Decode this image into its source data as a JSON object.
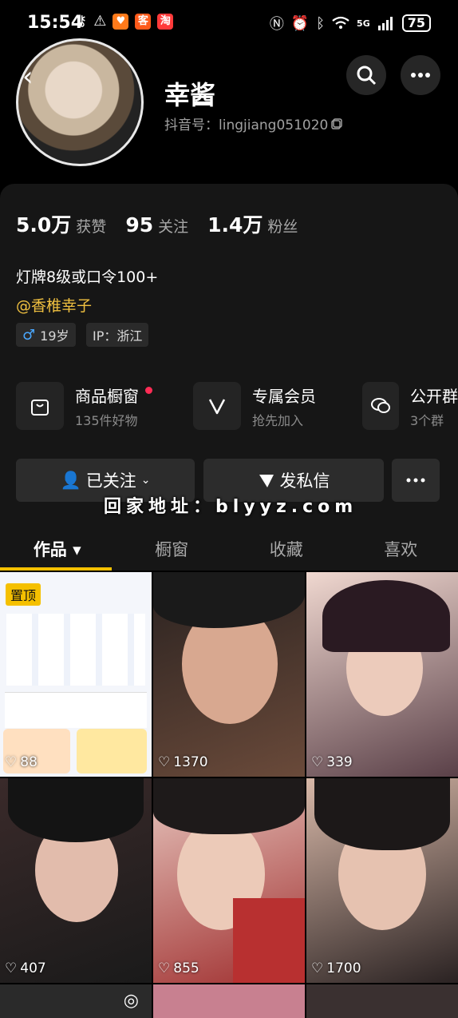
{
  "status_bar": {
    "time": "15:54",
    "battery": "75",
    "network": "5G",
    "left_badges": [
      {
        "text": "♥",
        "color": "#ff7a1a"
      },
      {
        "text": "客",
        "color": "#ff5a1a"
      },
      {
        "text": "淘",
        "color": "#ff3a3a"
      }
    ]
  },
  "profile": {
    "name": "幸酱",
    "douyin_id": "抖音号：lingjiang051020"
  },
  "stats": [
    {
      "value": "5.0万",
      "label": "获赞"
    },
    {
      "value": "95",
      "label": "关注"
    },
    {
      "value": "1.4万",
      "label": "粉丝"
    }
  ],
  "bio": {
    "line1": "灯牌8级或口令100+",
    "mention": "@香椎幸子",
    "tags": [
      {
        "icon": "male-icon",
        "text": "19岁"
      },
      {
        "icon": "",
        "text": "IP：浙江"
      }
    ]
  },
  "features": [
    {
      "icon": "shopping-bag-icon",
      "title": "商品橱窗",
      "sub": "135件好物"
    },
    {
      "icon": "vip-v-icon",
      "title": "专属会员",
      "sub": "抢先加入"
    },
    {
      "icon": "group-chat-icon",
      "title": "公开群",
      "sub": "3个群"
    }
  ],
  "actions": {
    "follow_label": "已关注",
    "message_label": "发私信"
  },
  "watermark": "回家地址：blyyz.com",
  "tabs": [
    {
      "label": "作品 ▾"
    },
    {
      "label": "橱窗"
    },
    {
      "label": "收藏"
    },
    {
      "label": "喜欢"
    }
  ],
  "videos": [
    {
      "likes": "88",
      "pinned": "置顶",
      "colors": [
        "#ffffff",
        "#e8f0ff"
      ]
    },
    {
      "likes": "1370",
      "colors": [
        "#c89a86",
        "#3a2a22"
      ]
    },
    {
      "likes": "339",
      "colors": [
        "#e8c0b0",
        "#5a3a42"
      ]
    },
    {
      "likes": "407",
      "colors": [
        "#d8b0a0",
        "#1a1a1a"
      ]
    },
    {
      "likes": "855",
      "colors": [
        "#e8c8b8",
        "#a83030"
      ]
    },
    {
      "likes": "1700",
      "colors": [
        "#c8a090",
        "#2a2a2a"
      ]
    }
  ],
  "colors": {
    "accent": "#f5c000",
    "mention": "#f0c040",
    "red_dot": "#fe2c55"
  }
}
